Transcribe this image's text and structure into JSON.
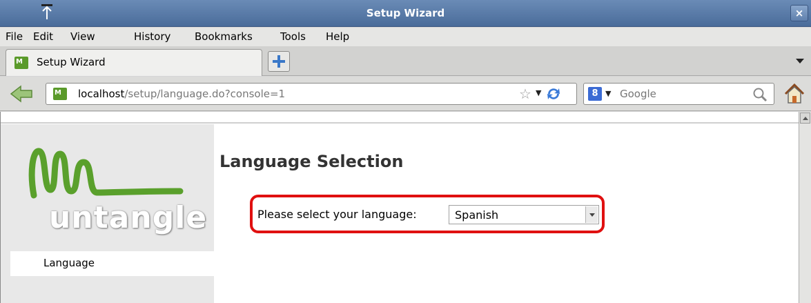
{
  "window": {
    "title": "Setup Wizard",
    "close_label": "×"
  },
  "menu": [
    {
      "label": "File"
    },
    {
      "label": "Edit"
    },
    {
      "label": "View"
    },
    {
      "label": "History"
    },
    {
      "label": "Bookmarks"
    },
    {
      "label": "Tools"
    },
    {
      "label": "Help"
    }
  ],
  "tabs": [
    {
      "label": "Setup Wizard",
      "icon": "untangle-favicon"
    }
  ],
  "navbar": {
    "url_host": "localhost",
    "url_path": "/setup/language.do?console=1",
    "search_placeholder": "Google",
    "search_engine": "8"
  },
  "sidebar": {
    "logo_text": "untangle",
    "items": [
      {
        "label": "Language"
      }
    ]
  },
  "main": {
    "title": "Language Selection",
    "language_prompt": "Please select your language:",
    "language_value": "Spanish"
  },
  "colors": {
    "highlight": "#e01010",
    "logo_green": "#5aa02c",
    "titlebar": "#5a7ba8"
  }
}
